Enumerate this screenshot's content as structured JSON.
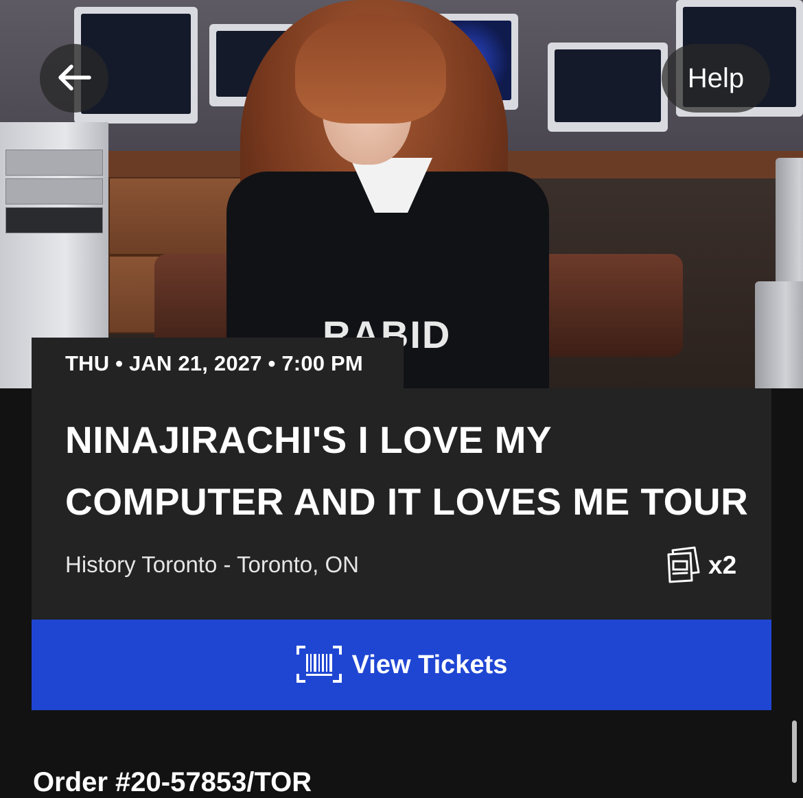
{
  "header": {
    "help_label": "Help"
  },
  "event": {
    "datetime": "THU • JAN 21, 2027 • 7:00 PM",
    "title_line1": "NINAJIRACHI'S I LOVE MY",
    "title_line2": "COMPUTER AND IT LOVES ME TOUR",
    "venue": "History Toronto - Toronto, ON",
    "ticket_quantity": "x2"
  },
  "actions": {
    "view_tickets_label": "View Tickets"
  },
  "order": {
    "number_partial": "Order #20-57853/TOR"
  },
  "hero": {
    "shirt_text": "RABID"
  },
  "colors": {
    "background": "#121212",
    "card": "#232323",
    "primary_button": "#1f46d3"
  },
  "icons": {
    "back": "arrow-left-icon",
    "tickets": "ticket-stack-icon",
    "barcode": "barcode-icon"
  }
}
